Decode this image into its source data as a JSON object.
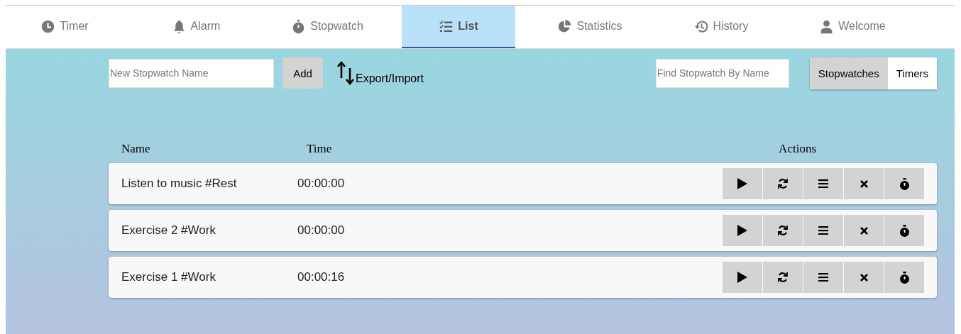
{
  "tabs": [
    {
      "kind": "clock",
      "label": "Timer",
      "selected": false
    },
    {
      "kind": "bell",
      "label": "Alarm",
      "selected": false
    },
    {
      "kind": "stopwatch",
      "label": "Stopwatch",
      "selected": false
    },
    {
      "kind": "list",
      "label": "List",
      "selected": true
    },
    {
      "kind": "pie",
      "label": "Statistics",
      "selected": false
    },
    {
      "kind": "history",
      "label": "History",
      "selected": false
    },
    {
      "kind": "user",
      "label": "Welcome",
      "selected": false
    }
  ],
  "toolbar": {
    "new_name": {
      "placeholder": "New Stopwatch Name"
    },
    "add_button": "Add",
    "export_import": "Export/Import",
    "search": {
      "placeholder": "Find Stopwatch By Name"
    },
    "toggle": [
      {
        "label": "Stopwatches",
        "selected": true
      },
      {
        "label": "Timers",
        "selected": false
      }
    ]
  },
  "table": {
    "columns": [
      "Name",
      "Time",
      "Actions"
    ],
    "rows": [
      {
        "name": "Listen to music #Rest",
        "time": "00:00:00"
      },
      {
        "name": "Exercise 2 #Work",
        "time": "00:00:00"
      },
      {
        "name": "Exercise 1 #Work",
        "time": "00:00:16"
      }
    ],
    "actions": [
      {
        "kind": "play"
      },
      {
        "kind": "reset"
      },
      {
        "kind": "menu"
      },
      {
        "kind": "delete"
      },
      {
        "kind": "stopwatch"
      }
    ]
  }
}
